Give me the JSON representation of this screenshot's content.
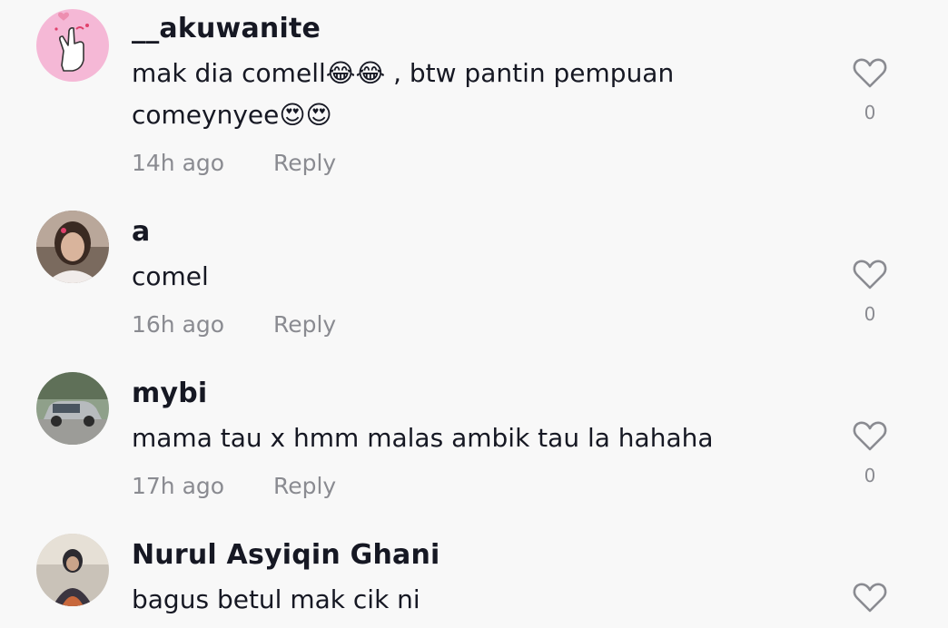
{
  "comments": [
    {
      "username": "__akuwanite",
      "text": "mak dia comell😂😂 , btw pantin pempuan comeynyee😍😍",
      "time": "14h ago",
      "reply_label": "Reply",
      "likes": "0",
      "avatar_icon": "finger-heart-icon"
    },
    {
      "username": "a",
      "text": "comel",
      "time": "16h ago",
      "reply_label": "Reply",
      "likes": "0",
      "avatar_icon": "user-photo"
    },
    {
      "username": "mybi",
      "text": "mama tau x hmm malas ambik tau la hahaha",
      "time": "17h ago",
      "reply_label": "Reply",
      "likes": "0",
      "avatar_icon": "car-photo"
    },
    {
      "username": "Nurul Asyiqin Ghani",
      "text": "bagus betul mak cik ni",
      "avatar_icon": "user-photo"
    }
  ],
  "colors": {
    "text_primary": "#161823",
    "text_secondary": "#8a8b91",
    "background": "#f8f8f8",
    "accent_pink": "#f5b8d6"
  }
}
